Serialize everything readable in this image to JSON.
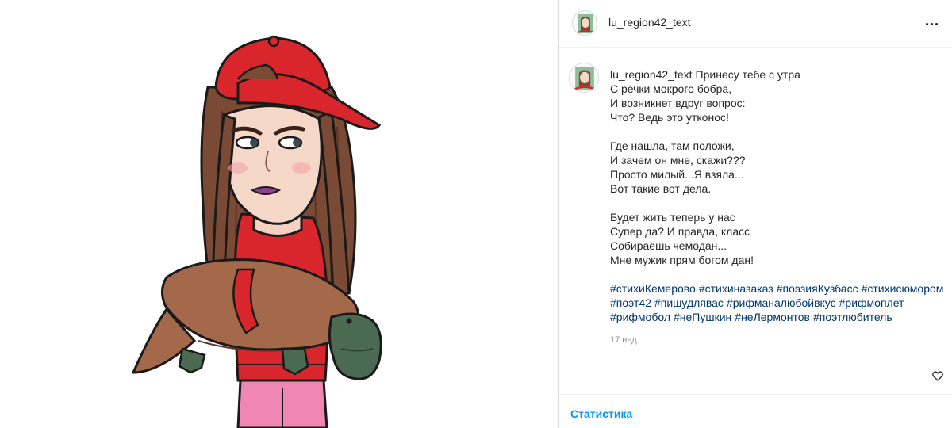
{
  "post": {
    "username": "lu_region42_text",
    "menu_icon": "more-horizontal-icon"
  },
  "caption": {
    "username": "lu_region42_text",
    "first_line": "Принесу тебе с утра",
    "lines": [
      "С речки мокрого бобра,",
      "И возникнет вдруг вопрос:",
      "Что? Ведь это утконос!",
      "",
      "Где нашла, там положи,",
      "И зачем он мне, скажи???",
      "Просто милый...Я взяла...",
      "Вот такие вот дела.",
      "",
      "Будет жить теперь у нас",
      "Супер да? И правда, класс",
      "Собираешь чемодан...",
      "Мне мужик прям богом дан!"
    ],
    "hashtags": [
      "#стихиКемерово",
      "#стихиназаказ",
      "#поэзияКузбасс",
      "#стихисюмором",
      "#поэт42",
      "#пишудлявас",
      "#рифманалюбойвкус",
      "#рифмоплет",
      "#рифмобол",
      "#неПушкин",
      "#неЛермонтов",
      "#поэтлюбитель"
    ],
    "time": "17 нед."
  },
  "footer": {
    "stats_label": "Статистика"
  },
  "colors": {
    "link": "#00376b",
    "accent": "#0095f6",
    "cap": "#d9262c",
    "hair": "#7a4a35",
    "platypus": "#a4684a"
  }
}
